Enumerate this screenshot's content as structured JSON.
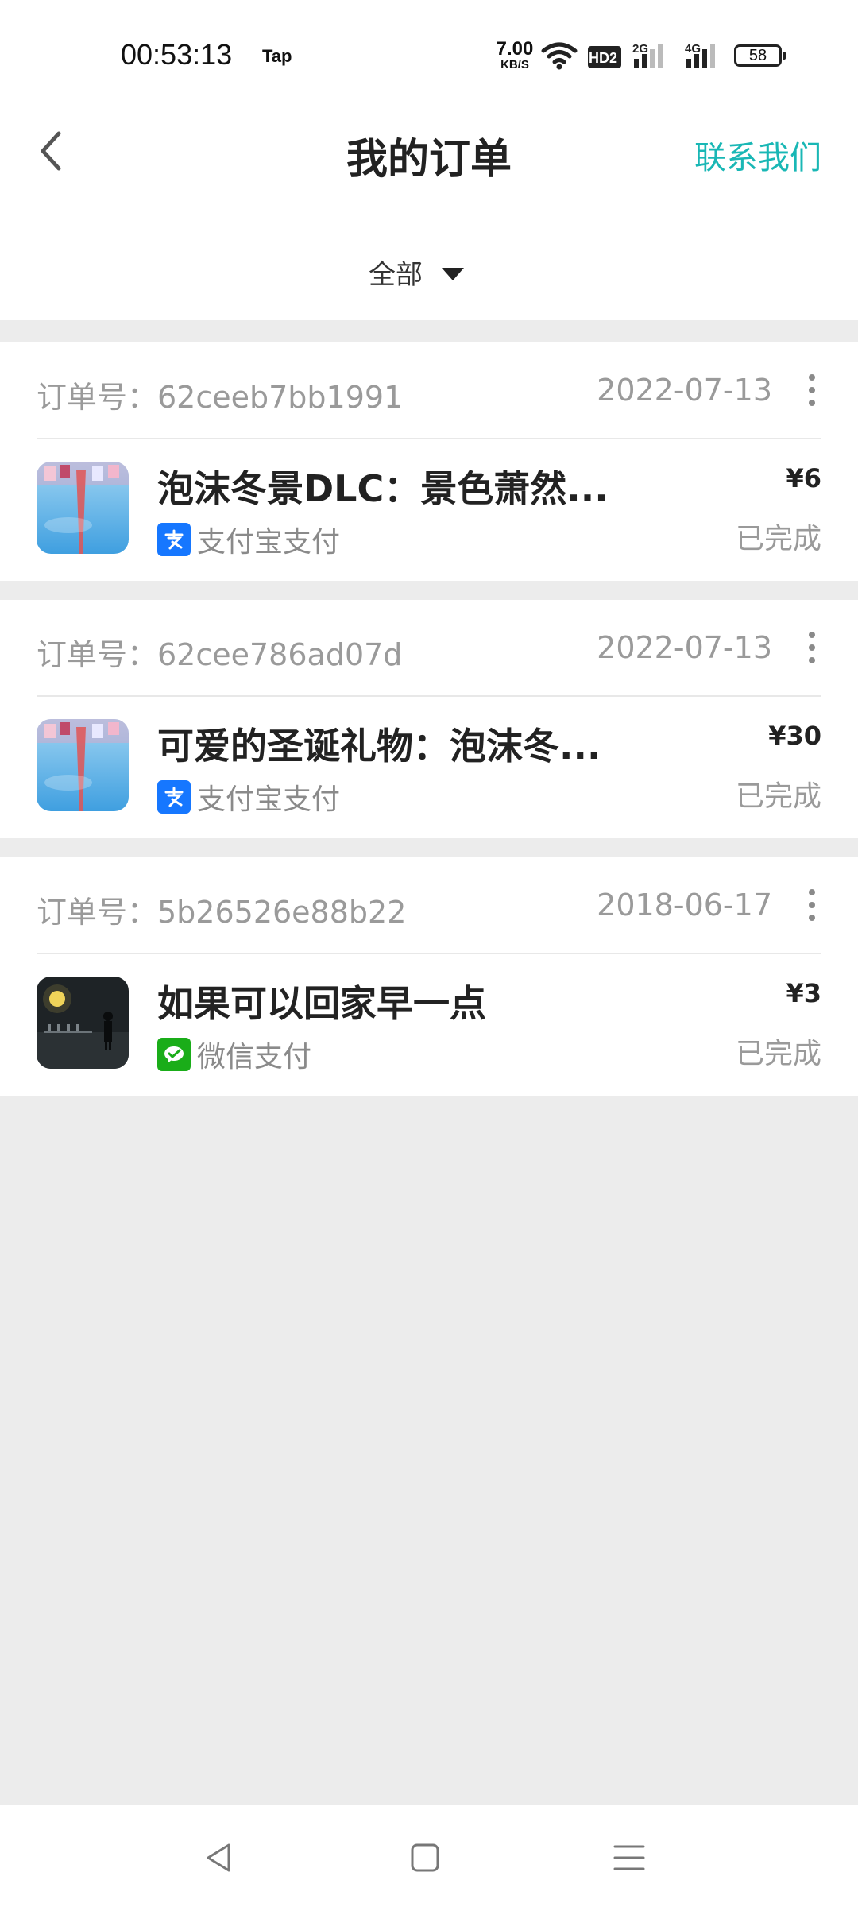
{
  "status_bar": {
    "time": "00:53:13",
    "app_indicator": "Tap",
    "net_speed_value": "7.00",
    "net_speed_unit": "KB/S",
    "hd_label": "HD2",
    "sig1_label": "2G",
    "sig2_label": "4G",
    "battery": "58",
    "icons": [
      "wifi-icon",
      "hd-icon",
      "signal-icon",
      "battery-icon"
    ]
  },
  "header": {
    "title": "我的订单",
    "contact_label": "联系我们",
    "back_icon": "chevron-left-icon"
  },
  "filter": {
    "label": "全部",
    "icon": "triangle-down-icon"
  },
  "orders": [
    {
      "order_id": "订单号：62ceeb7bb1991",
      "date": "2022-07-13",
      "title": "泡沫冬景DLC：景色萧然...",
      "payment": "支付宝支付",
      "payment_icon": "alipay-icon",
      "price": "¥6",
      "status": "已完成"
    },
    {
      "order_id": "订单号：62cee786ad07d",
      "date": "2022-07-13",
      "title": "可爱的圣诞礼物：泡沫冬...",
      "payment": "支付宝支付",
      "payment_icon": "alipay-icon",
      "price": "¥30",
      "status": "已完成"
    },
    {
      "order_id": "订单号：5b26526e88b22",
      "date": "2018-06-17",
      "title": "如果可以回家早一点",
      "payment": "微信支付",
      "payment_icon": "wechat-pay-icon",
      "price": "¥3",
      "status": "已完成"
    }
  ],
  "colors": {
    "accent": "#19b7b5",
    "alipay": "#1677ff",
    "wechat": "#1aad19",
    "page_bg": "#ececec"
  },
  "nav_bar": {
    "icons": [
      "back-triangle-icon",
      "home-square-icon",
      "menu-lines-icon"
    ]
  }
}
